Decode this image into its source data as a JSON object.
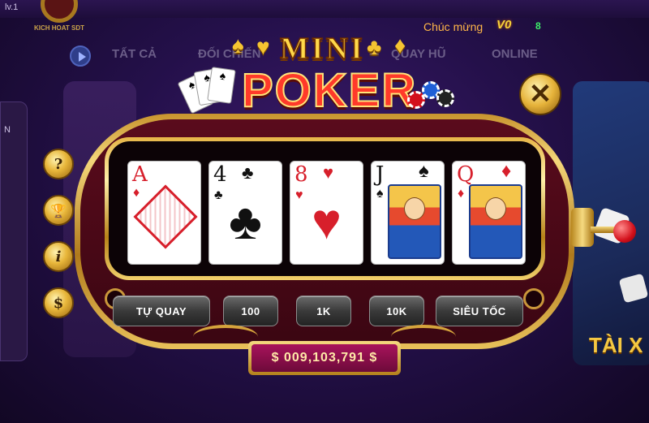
{
  "lobby": {
    "level": "lv.1",
    "logo_text": "KICH HOAT SDT",
    "greeting": "Chúc mừng",
    "vip_badge": "V0",
    "balance": "8",
    "tabs": [
      "TẤT CẢ",
      "ĐỐI CHIẾN",
      "QUAY HŨ",
      "ONLINE"
    ],
    "left_strip_text": "N",
    "right_card_text": "TÀI X"
  },
  "game": {
    "title_top": "MINI",
    "title_main": "POKER",
    "close_label": "✕",
    "cards": [
      {
        "rank": "A",
        "suit": "♦",
        "color": "red"
      },
      {
        "rank": "4",
        "suit": "♣",
        "color": "blk"
      },
      {
        "rank": "8",
        "suit": "♥",
        "color": "red"
      },
      {
        "rank": "J",
        "suit": "♠",
        "color": "blk"
      },
      {
        "rank": "Q",
        "suit": "♦",
        "color": "red"
      }
    ],
    "buttons": {
      "auto_spin": "TỰ QUAY",
      "bet_100": "100",
      "bet_1k": "1K",
      "bet_10k": "10K",
      "turbo": "SIÊU TỐC"
    },
    "jackpot": "$ 009,103,791 $",
    "side_buttons": [
      {
        "icon": "help-icon",
        "glyph": "?"
      },
      {
        "icon": "trophy-icon",
        "glyph": "🏆"
      },
      {
        "icon": "info-icon",
        "glyph": "i"
      },
      {
        "icon": "money-bag-icon",
        "glyph": "$"
      }
    ]
  },
  "colors": {
    "accent_gold": "#f5c431",
    "title_red": "#ff3a2a",
    "jackpot_bg": "#a8135b"
  }
}
